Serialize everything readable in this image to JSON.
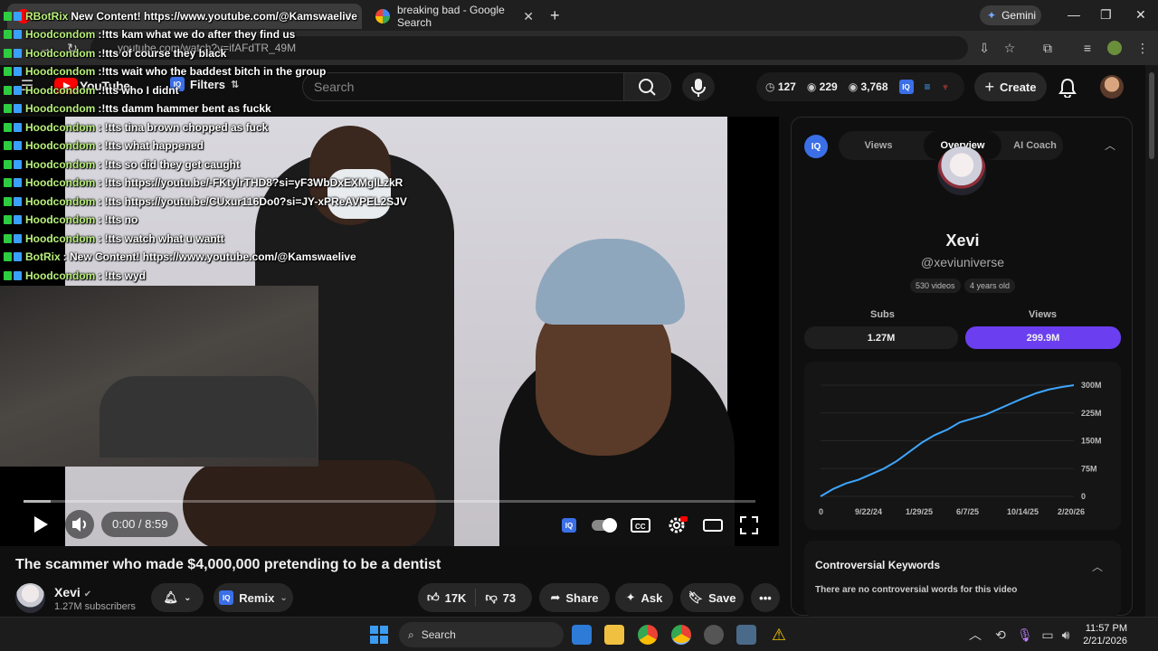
{
  "browser": {
    "tabs": [
      {
        "title": "",
        "active": true
      },
      {
        "title": "breaking bad - Google Search",
        "active": false
      }
    ],
    "gemini_label": "Gemini",
    "url": "youtube.com/watch?v=ifAFdTR_49M"
  },
  "masthead": {
    "logo_text": "YouTube",
    "filters_label": "Filters",
    "search_placeholder": "Search",
    "stats": {
      "watch_time": "127",
      "views_a": "229",
      "views_b": "3,768"
    },
    "create_label": "Create"
  },
  "chat": {
    "lines": [
      {
        "user": "RBotRix",
        "msg": "New Content! https://www.youtube.com/@Kamswaelive",
        "bot": true
      },
      {
        "user": "Hoodcondom",
        "msg": ":!tts kam what we do after they find us"
      },
      {
        "user": "Hoodcondom",
        "msg": ":!tts of course they black"
      },
      {
        "user": "Hoodcondom",
        "msg": ":!tts wait who the baddest bitch in the group"
      },
      {
        "user": "Hoodcondom",
        "msg": ":!tts who I didnt"
      },
      {
        "user": "Hoodcondom",
        "msg": ":!tts damm hammer bent as fuckk"
      },
      {
        "user": "Hoodcondom",
        "msg": ": !tts tina brown chopped as fuck"
      },
      {
        "user": "Hoodcondom",
        "msg": ": !tts what happened"
      },
      {
        "user": "Hoodcondom",
        "msg": ": !tts so did they get caught"
      },
      {
        "user": "Hoodcondom",
        "msg": ": !tts https://youtu.be/-FKtylrTHD8?si=yF3WbDxEXMglLzkR"
      },
      {
        "user": "Hoodcondom",
        "msg": ": !tts https://youtu.be/CUxur116Do0?si=JY-xPReAVPEL2SJV"
      },
      {
        "user": "Hoodcondom",
        "msg": ": !tts no"
      },
      {
        "user": "Hoodcondom",
        "msg": ": !tts watch what u wantt"
      },
      {
        "user": "BotRix",
        "msg": ": New Content! https://www.youtube.com/@Kamswaelive",
        "bot": true
      },
      {
        "user": "Hoodcondom",
        "msg": ": !tts wyd"
      }
    ]
  },
  "player": {
    "time": "0:00 / 8:59",
    "progress_fraction": 0.0
  },
  "video": {
    "title": "The scammer who made $4,000,000 pretending to be a dentist",
    "channel": "Xevi",
    "subscribers": "1.27M subscribers",
    "remix_label": "Remix",
    "likes": "17K",
    "dislikes": "73",
    "share_label": "Share",
    "ask_label": "Ask",
    "save_label": "Save"
  },
  "panel": {
    "tabs": [
      "Views",
      "Overview",
      "AI Coach"
    ],
    "active_tab": "Overview",
    "channel_name": "Xevi",
    "handle": "@xeviuniverse",
    "chips": [
      "530 videos",
      "4 years old"
    ],
    "subs_label": "Subs",
    "subs_value": "1.27M",
    "views_label": "Views",
    "views_value": "299.9M",
    "controversial_title": "Controversial Keywords",
    "controversial_text": "There are no controversial words for this video"
  },
  "chart_data": {
    "type": "line",
    "x_tick_labels": [
      "0",
      "9/22/24",
      "1/29/25",
      "6/7/25",
      "10/14/25",
      "2/20/26"
    ],
    "y_tick_labels": [
      "0",
      "75M",
      "150M",
      "225M",
      "300M"
    ],
    "ylim": [
      0,
      300
    ],
    "series": [
      {
        "x": [
          0,
          0.05,
          0.1,
          0.15,
          0.2,
          0.25,
          0.3,
          0.35,
          0.4,
          0.45,
          0.5,
          0.55,
          0.6,
          0.65,
          0.7,
          0.75,
          0.8,
          0.85,
          0.9,
          0.95,
          1.0
        ],
        "values": [
          0,
          20,
          35,
          45,
          60,
          75,
          95,
          120,
          145,
          165,
          180,
          200,
          210,
          220,
          235,
          250,
          265,
          278,
          288,
          295,
          300
        ]
      }
    ],
    "color": "#3ea6ff",
    "grid": true
  },
  "taskbar": {
    "search_label": "Search",
    "time": "11:57 PM",
    "date": "2/21/2026"
  },
  "colors": {
    "accent_purple": "#6b3ff0",
    "iq_blue": "#3b6fe8",
    "chart_line": "#3ea6ff",
    "chat_user": "#b8f07a"
  }
}
